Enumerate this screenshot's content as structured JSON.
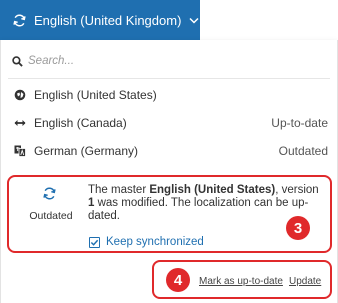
{
  "language_button": {
    "label": "English (United Kingdom)",
    "icon": "sync-icon",
    "chevron": "chevron-down-icon"
  },
  "search": {
    "placeholder": "Search..."
  },
  "languages": [
    {
      "name": "English (United States)",
      "status": "",
      "icon": "master-globe-icon"
    },
    {
      "name": "English (Canada)",
      "status": "Up-to-date",
      "icon": "arrows-horizontal-icon"
    },
    {
      "name": "German (Germany)",
      "status": "Outdated",
      "icon": "translate-icon"
    }
  ],
  "detail": {
    "status": "Outdated",
    "message_prefix": "The master ",
    "message_master": "English (United States)",
    "message_mid": ", version ",
    "message_version": "1",
    "message_suffix": " was modified. The localization can be up-dated.",
    "keep_sync_label": "Keep synchronized",
    "keep_sync_checked": true,
    "callout_number": "3"
  },
  "actions": {
    "callout_number": "4",
    "mark_label": "Mark as up-to-date",
    "update_label": "Update"
  },
  "colors": {
    "accent": "#1f6fb0",
    "callout": "#e0292b"
  }
}
